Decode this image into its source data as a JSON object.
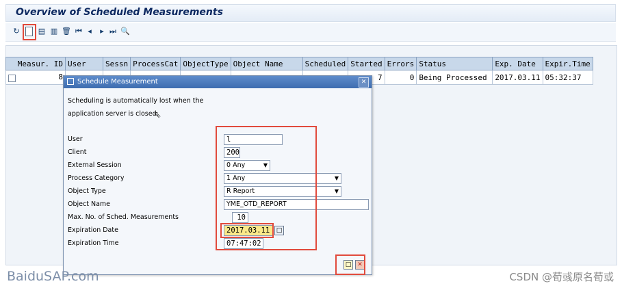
{
  "window": {
    "title": "Overview of Scheduled Measurements"
  },
  "toolbar": {
    "icons": [
      "refresh-icon",
      "new-document-icon",
      "details-icon",
      "print-icon",
      "delete-icon",
      "first-page-icon",
      "previous-page-icon",
      "next-page-icon",
      "last-page-icon",
      "find-icon"
    ]
  },
  "table": {
    "headers": [
      "Measur. ID",
      "User",
      "Sessn",
      "ProcessCat",
      "ObjectType",
      "Object Name",
      "Scheduled",
      "Started",
      "Errors",
      "Status",
      "Exp. Date",
      "Expir.Time"
    ],
    "rows": [
      {
        "measur_id": "8",
        "started": "7",
        "errors": "0",
        "status": "Being Processed",
        "exp_date": "2017.03.11",
        "expir_time": "05:32:37"
      }
    ]
  },
  "dialog": {
    "title": "Schedule Measurement",
    "info_line1": "Scheduling is automatically lost when the",
    "info_line2": "application server is closed.",
    "labels": {
      "user": "User",
      "client": "Client",
      "external_session": "External Session",
      "process_category": "Process Category",
      "object_type": "Object Type",
      "object_name": "Object Name",
      "max_measurements": "Max. No. of Sched. Measurements",
      "expiration_date": "Expiration Date",
      "expiration_time": "Expiration Time"
    },
    "values": {
      "user": "l",
      "client": "200",
      "external_session": "0 Any",
      "process_category": "1 Any",
      "object_type": "R Report",
      "object_name": "YME_OTD_REPORT",
      "max_measurements": "10",
      "expiration_date": "2017.03.11",
      "expiration_time": "07:47:02"
    }
  },
  "watermarks": {
    "left": "BaiduSAP.com",
    "right": "CSDN @荀彧原名荀或"
  },
  "colors": {
    "highlight": "#e14a3c",
    "header_bg": "#c8d8ea",
    "dialog_title": "#3e6db0",
    "date_field": "#fbe98a"
  }
}
